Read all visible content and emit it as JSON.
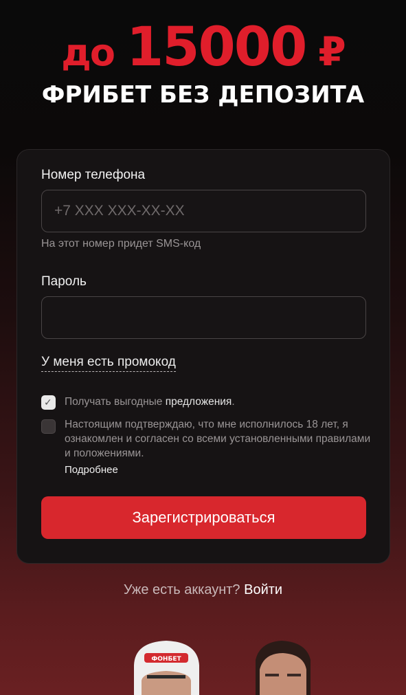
{
  "promo": {
    "prefix": "до",
    "amount": "15000",
    "currency": "₽",
    "subtitle": "ФРИБЕТ БЕЗ ДЕПОЗИТА"
  },
  "form": {
    "phone_label": "Номер телефона",
    "phone_placeholder": "+7 XXX XXX-XX-XX",
    "phone_value": "",
    "phone_hint": "На этот номер придет SMS-код",
    "password_label": "Пароль",
    "password_value": "",
    "promo_link": "У меня есть промокод",
    "offers_checkbox": {
      "checked": true,
      "text_plain": "Получать выгодные ",
      "text_highlight": "предложения",
      "text_end": "."
    },
    "age_checkbox": {
      "checked": false,
      "text": "Настоящим подтверждаю, что мне исполнилось 18 лет, я ознакомлен и согласен со всеми установленными правилами и положениями."
    },
    "more_link": "Подробнее",
    "submit_label": "Зарегистрироваться"
  },
  "footer": {
    "question": "Уже есть аккаунт? ",
    "login_link": "Войти"
  },
  "helmet_logo": "ФОНБЕТ",
  "colors": {
    "accent": "#d8272d",
    "promo_red": "#e01e2b",
    "card_bg": "#161314"
  }
}
